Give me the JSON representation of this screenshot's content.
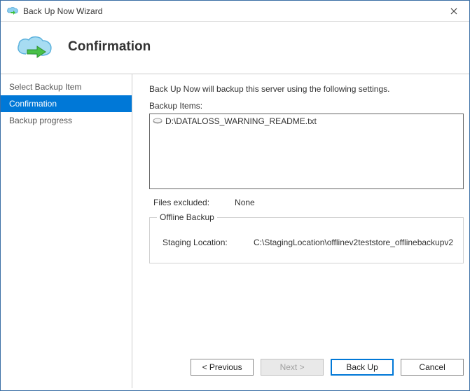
{
  "window": {
    "title": "Back Up Now Wizard"
  },
  "header": {
    "title": "Confirmation"
  },
  "sidebar": {
    "items": [
      {
        "label": "Select Backup Item",
        "selected": false
      },
      {
        "label": "Confirmation",
        "selected": true
      },
      {
        "label": "Backup progress",
        "selected": false
      }
    ]
  },
  "main": {
    "intro": "Back Up Now will backup this server using the following settings.",
    "items_label": "Backup Items:",
    "backup_items": [
      {
        "icon": "drive-icon",
        "path": "D:\\DATALOSS_WARNING_README.txt"
      }
    ],
    "files_excluded_label": "Files excluded:",
    "files_excluded_value": "None",
    "offline_group_title": "Offline Backup",
    "staging_label": "Staging Location:",
    "staging_value": "C:\\StagingLocation\\offlinev2teststore_offlinebackupv2"
  },
  "buttons": {
    "previous": "< Previous",
    "next": "Next >",
    "backup": "Back Up",
    "cancel": "Cancel"
  }
}
